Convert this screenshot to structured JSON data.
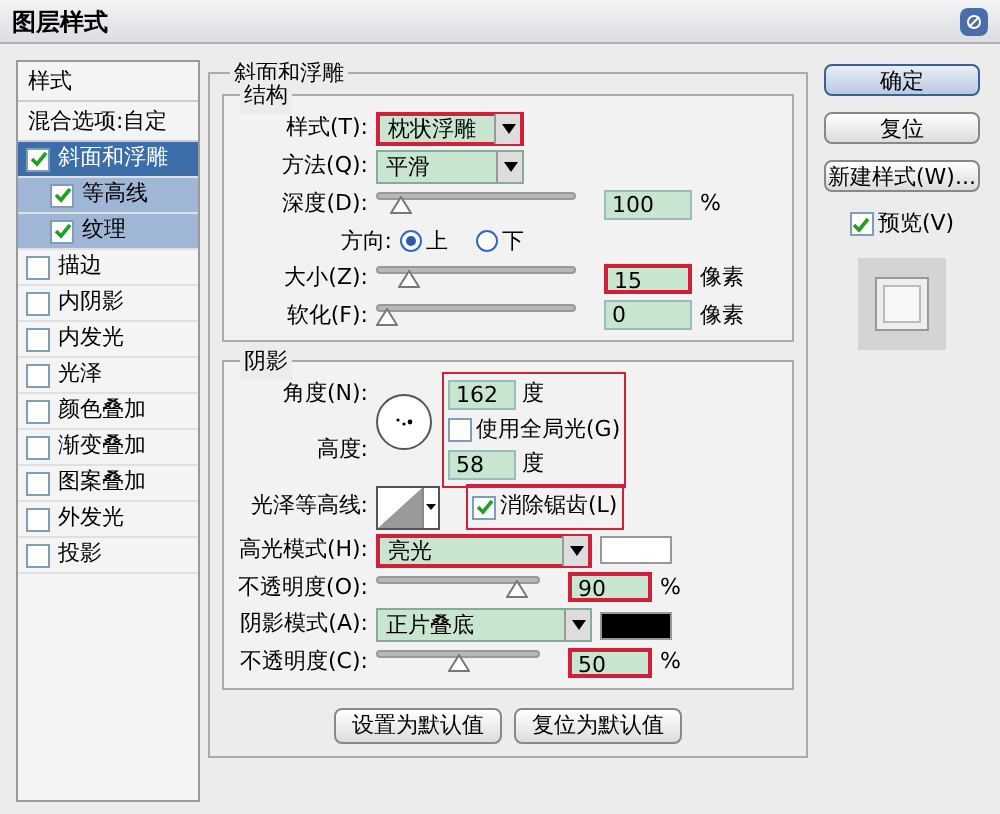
{
  "window": {
    "title": "图层样式"
  },
  "sidebar": {
    "header": "样式",
    "blend_options": "混合选项:自定",
    "items": [
      {
        "label": "斜面和浮雕",
        "checked": true,
        "selected": true,
        "children": [
          {
            "label": "等高线",
            "checked": true,
            "selected": false
          },
          {
            "label": "纹理",
            "checked": true,
            "selected": false
          }
        ]
      },
      {
        "label": "描边",
        "checked": false,
        "selected": false
      },
      {
        "label": "内阴影",
        "checked": false,
        "selected": false
      },
      {
        "label": "内发光",
        "checked": false,
        "selected": false
      },
      {
        "label": "光泽",
        "checked": false,
        "selected": false
      },
      {
        "label": "颜色叠加",
        "checked": false,
        "selected": false
      },
      {
        "label": "渐变叠加",
        "checked": false,
        "selected": false
      },
      {
        "label": "图案叠加",
        "checked": false,
        "selected": false
      },
      {
        "label": "外发光",
        "checked": false,
        "selected": false
      },
      {
        "label": "投影",
        "checked": false,
        "selected": false
      }
    ]
  },
  "bevel": {
    "title": "斜面和浮雕",
    "structure": {
      "title": "结构",
      "style": {
        "label": "样式(T):",
        "value": "枕状浮雕",
        "highlighted": true
      },
      "technique": {
        "label": "方法(Q):",
        "value": "平滑"
      },
      "depth": {
        "label": "深度(D):",
        "level": 0.08,
        "value": "100",
        "unit": "%"
      },
      "direction": {
        "label": "方向:",
        "options": [
          {
            "label": "上",
            "selected": true
          },
          {
            "label": "下",
            "selected": false
          }
        ]
      },
      "size": {
        "label": "大小(Z):",
        "level": 0.12,
        "value": "15",
        "unit": "像素",
        "highlighted": true
      },
      "soften": {
        "label": "软化(F):",
        "level": 0,
        "value": "0",
        "unit": "像素"
      }
    },
    "shading": {
      "title": "阴影",
      "angle": {
        "label": "角度(N):",
        "value": "162",
        "unit": "度",
        "highlighted": true
      },
      "global_light": {
        "label": "使用全局光(G)",
        "checked": false
      },
      "altitude": {
        "label": "高度:",
        "value": "58",
        "unit": "度"
      },
      "gloss_contour": {
        "label": "光泽等高线:"
      },
      "anti_aliased": {
        "label": "消除锯齿(L)",
        "checked": true,
        "highlighted": true
      },
      "highlight_mode": {
        "label": "高光模式(H):",
        "value": "亮光",
        "color": "#ffffff",
        "highlighted": true
      },
      "highlight_opacity": {
        "label": "不透明度(O):",
        "level": 0.92,
        "value": "90",
        "unit": "%",
        "highlighted": true
      },
      "shadow_mode": {
        "label": "阴影模式(A):",
        "value": "正片叠底",
        "color": "#000000"
      },
      "shadow_opacity": {
        "label": "不透明度(C):",
        "level": 0.5,
        "value": "50",
        "unit": "%",
        "highlighted": true
      }
    },
    "buttons": [
      "设置为默认值",
      "复位为默认值"
    ]
  },
  "actions": {
    "buttons": [
      {
        "label": "确定",
        "default": true
      },
      {
        "label": "复位",
        "default": false
      },
      {
        "label": "新建样式(W)...",
        "default": false
      }
    ],
    "preview": {
      "label": "预览(V)",
      "checked": true
    }
  }
}
